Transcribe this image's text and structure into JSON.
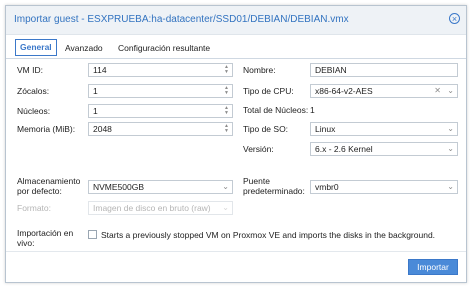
{
  "dialog": {
    "title": "Importar guest - ESXPRUEBA:ha-datacenter/SSD01/DEBIAN/DEBIAN.vmx",
    "close_icon": "close-circle-icon"
  },
  "tabs": [
    {
      "label": "General",
      "active": true
    },
    {
      "label": "Avanzado",
      "active": false
    },
    {
      "label": "Configuración resultante",
      "active": false
    }
  ],
  "left": {
    "vmid": {
      "label": "VM ID:",
      "value": "114"
    },
    "sockets": {
      "label": "Zócalos:",
      "value": "1"
    },
    "cores": {
      "label": "Núcleos:",
      "value": "1"
    },
    "memory": {
      "label": "Memoria (MiB):",
      "value": "2048"
    }
  },
  "right": {
    "name": {
      "label": "Nombre:",
      "value": "DEBIAN"
    },
    "cpu": {
      "label": "Tipo de CPU:",
      "value": "x86-64-v2-AES"
    },
    "total_cores": {
      "label": "Total de Núcleos:",
      "value": "1"
    },
    "os_type": {
      "label": "Tipo de SO:",
      "value": "Linux"
    },
    "version": {
      "label": "Versión:",
      "value": "6.x - 2.6 Kernel"
    }
  },
  "storage": {
    "label_line1": "Almacenamiento",
    "label_line2": "por defecto:",
    "value": "NVME500GB"
  },
  "format": {
    "label": "Formato:",
    "value": "Imagen de disco en bruto (raw)"
  },
  "bridge": {
    "label_line1": "Puente",
    "label_line2": "predeterminado:",
    "value": "vmbr0"
  },
  "live_import": {
    "label_line1": "Importación en",
    "label_line2": "vivo:",
    "checked": false,
    "description": "Starts a previously stopped VM on Proxmox VE and imports the disks in the background."
  },
  "footer": {
    "import_button": "Importar"
  }
}
